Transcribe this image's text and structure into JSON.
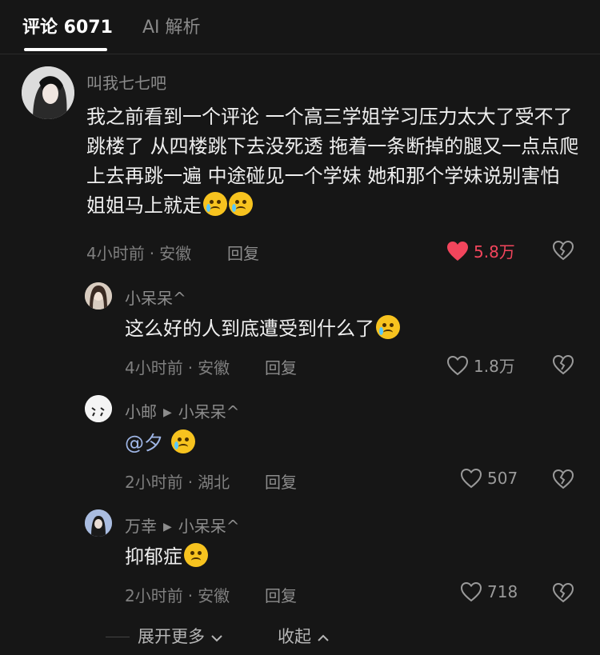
{
  "tabs": {
    "comments": "评论 6071",
    "ai": "AI 解析"
  },
  "main_comment": {
    "user": "叫我七七吧",
    "text": "我之前看到一个评论 一个高三学姐学习压力太大了受不了跳楼了 从四楼跳下去没死透 拖着一条断掉的腿又一点点爬上去再跳一遍 中途碰见一个学妹 她和那个学妹说别害怕 姐姐马上就走",
    "time": "4小时前",
    "location": "安徽",
    "reply": "回复",
    "likes": "5.8万"
  },
  "replies": [
    {
      "user": "小呆呆^",
      "reply_to": "",
      "text": "这么好的人到底遭受到什么了",
      "time": "4小时前",
      "location": "安徽",
      "reply": "回复",
      "likes": "1.8万"
    },
    {
      "user": "小邮",
      "reply_to": "小呆呆^",
      "text": "@夕",
      "time": "2小时前",
      "location": "湖北",
      "reply": "回复",
      "likes": "507"
    },
    {
      "user": "万幸",
      "reply_to": "小呆呆^",
      "text": "抑郁症",
      "time": "2小时前",
      "location": "安徽",
      "reply": "回复",
      "likes": "718"
    }
  ],
  "footer": {
    "expand": "展开更多",
    "collapse": "收起"
  },
  "colors": {
    "liked": "#f2455c",
    "background": "#161616"
  },
  "icons": [
    "heart-icon",
    "heart-filled-icon",
    "broken-heart-icon",
    "chevron-down-icon",
    "chevron-up-icon"
  ]
}
